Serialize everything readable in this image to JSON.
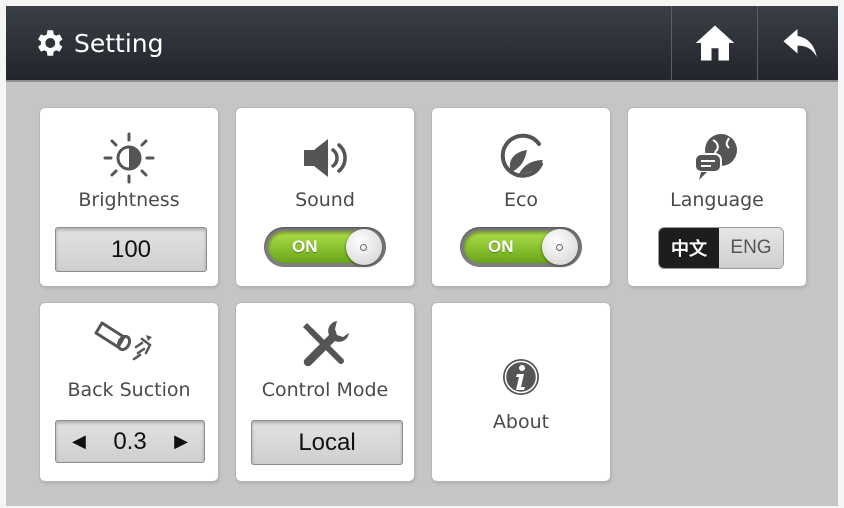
{
  "header": {
    "title": "Setting",
    "title_icon": "gear-icon",
    "home_icon": "home-icon",
    "back_icon": "back-arrow-icon"
  },
  "tiles": {
    "brightness": {
      "label": "Brightness",
      "value": "100",
      "icon": "brightness-icon"
    },
    "sound": {
      "label": "Sound",
      "toggle": "ON",
      "icon": "speaker-icon"
    },
    "eco": {
      "label": "Eco",
      "toggle": "ON",
      "icon": "leaf-icon"
    },
    "language": {
      "label": "Language",
      "option_zh": "中文",
      "option_en": "ENG",
      "selected": "中文",
      "icon": "language-icon"
    },
    "back_suction": {
      "label": "Back Suction",
      "value": "0.3",
      "decrease": "◀",
      "increase": "▶",
      "icon": "nozzle-icon"
    },
    "control_mode": {
      "label": "Control Mode",
      "value": "Local",
      "icon": "tools-icon"
    },
    "about": {
      "label": "About",
      "icon": "info-icon"
    }
  },
  "colors": {
    "header_bg": "#2b2f35",
    "panel_bg": "#c5c5c5",
    "toggle_on": "#8cc63f",
    "lang_selected": "#1d1d1d"
  }
}
